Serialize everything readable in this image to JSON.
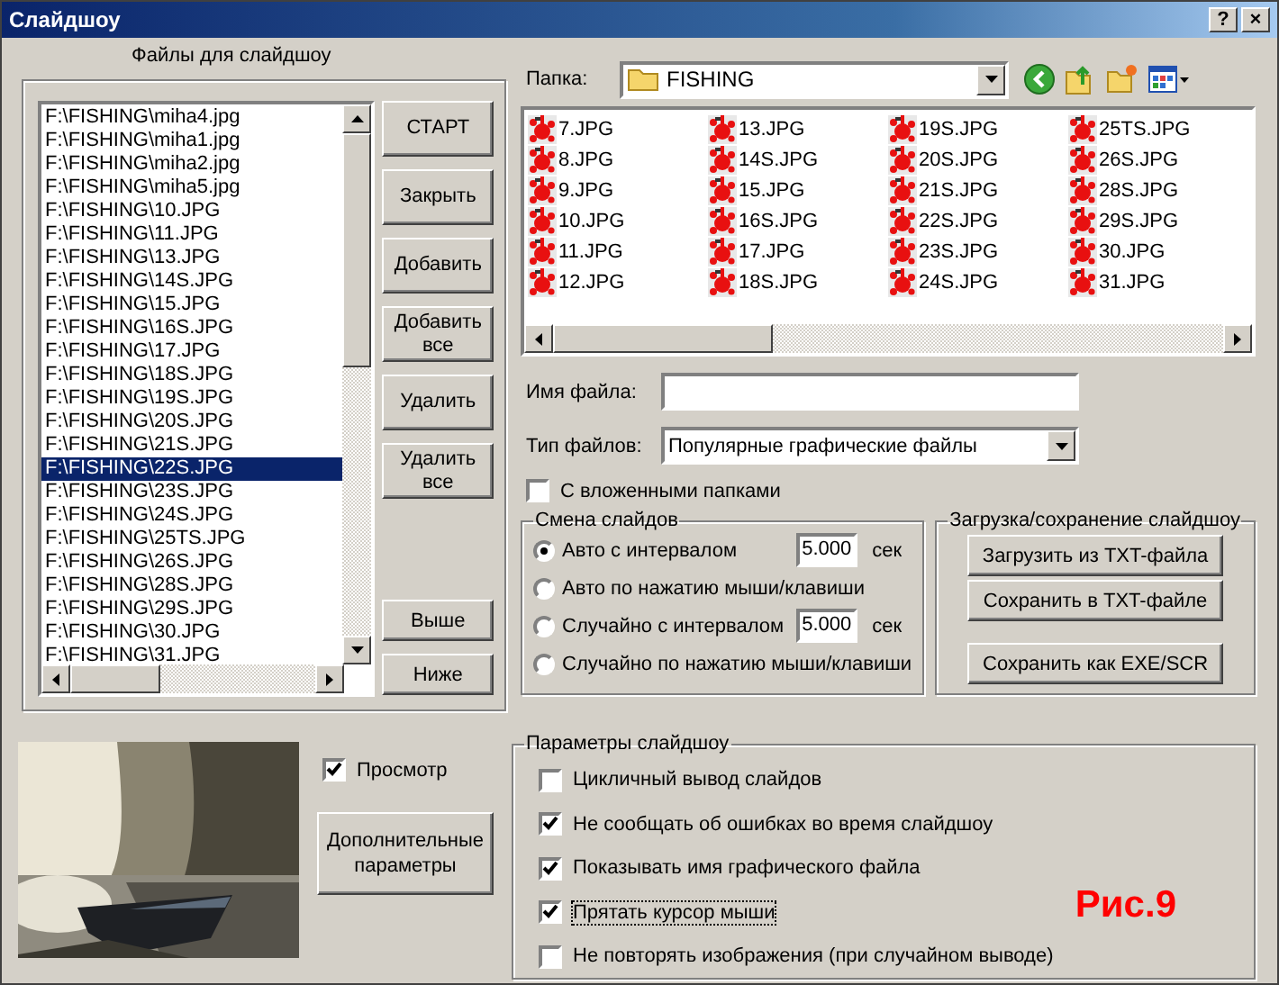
{
  "window": {
    "title": "Слайдшоу",
    "help_button": "?",
    "close_button": "×"
  },
  "files_panel": {
    "title": "Файлы для слайдшоу",
    "items": [
      {
        "name": "F:\\FISHING\\miha4.jpg",
        "selected": false
      },
      {
        "name": "F:\\FISHING\\miha1.jpg",
        "selected": false
      },
      {
        "name": "F:\\FISHING\\miha2.jpg",
        "selected": false
      },
      {
        "name": "F:\\FISHING\\miha5.jpg",
        "selected": false
      },
      {
        "name": "F:\\FISHING\\10.JPG",
        "selected": false
      },
      {
        "name": "F:\\FISHING\\11.JPG",
        "selected": false
      },
      {
        "name": "F:\\FISHING\\13.JPG",
        "selected": false
      },
      {
        "name": "F:\\FISHING\\14S.JPG",
        "selected": false
      },
      {
        "name": "F:\\FISHING\\15.JPG",
        "selected": false
      },
      {
        "name": "F:\\FISHING\\16S.JPG",
        "selected": false
      },
      {
        "name": "F:\\FISHING\\17.JPG",
        "selected": false
      },
      {
        "name": "F:\\FISHING\\18S.JPG",
        "selected": false
      },
      {
        "name": "F:\\FISHING\\19S.JPG",
        "selected": false
      },
      {
        "name": "F:\\FISHING\\20S.JPG",
        "selected": false
      },
      {
        "name": "F:\\FISHING\\21S.JPG",
        "selected": false
      },
      {
        "name": "F:\\FISHING\\22S.JPG",
        "selected": true
      },
      {
        "name": "F:\\FISHING\\23S.JPG",
        "selected": false
      },
      {
        "name": "F:\\FISHING\\24S.JPG",
        "selected": false
      },
      {
        "name": "F:\\FISHING\\25TS.JPG",
        "selected": false
      },
      {
        "name": "F:\\FISHING\\26S.JPG",
        "selected": false
      },
      {
        "name": "F:\\FISHING\\28S.JPG",
        "selected": false
      },
      {
        "name": "F:\\FISHING\\29S.JPG",
        "selected": false
      },
      {
        "name": "F:\\FISHING\\30.JPG",
        "selected": false
      },
      {
        "name": "F:\\FISHING\\31.JPG",
        "selected": false
      }
    ],
    "buttons_top": [
      "СТАРТ",
      "Закрыть",
      "Добавить",
      "Добавить все",
      "Удалить",
      "Удалить все"
    ],
    "buttons_bottom": [
      "Выше",
      "Ниже"
    ]
  },
  "folder": {
    "label": "Папка:",
    "value": "FISHING"
  },
  "files": [
    "7.JPG",
    "8.JPG",
    "9.JPG",
    "10.JPG",
    "11.JPG",
    "12.JPG",
    "13.JPG",
    "14S.JPG",
    "15.JPG",
    "16S.JPG",
    "17.JPG",
    "18S.JPG",
    "19S.JPG",
    "20S.JPG",
    "21S.JPG",
    "22S.JPG",
    "23S.JPG",
    "24S.JPG",
    "25TS.JPG",
    "26S.JPG",
    "28S.JPG",
    "29S.JPG",
    "30.JPG",
    "31.JPG"
  ],
  "file_name": {
    "label": "Имя файла:"
  },
  "file_type": {
    "label": "Тип файлов:",
    "value": "Популярные графические файлы"
  },
  "subfolders": {
    "label": "С вложенными папками",
    "checked": false
  },
  "slide_change": {
    "title": "Смена слайдов",
    "options": [
      {
        "label": "Авто  с  интервалом",
        "selected": true,
        "interval": "5.000",
        "unit": "сек"
      },
      {
        "label": "Авто по нажатию мыши/клавиши",
        "selected": false
      },
      {
        "label": "Случайно с интервалом",
        "selected": false,
        "interval": "5.000",
        "unit": "сек"
      },
      {
        "label": "Случайно по нажатию мыши/клавиши",
        "selected": false
      }
    ]
  },
  "save_load": {
    "title": "Загрузка/сохранение слайдшоу",
    "buttons": [
      "Загрузить из TXT-файла",
      "Сохранить в TXT-файле",
      "Сохранить как EXE/SCR"
    ]
  },
  "preview": {
    "label": "Просмотр",
    "checked": true
  },
  "more_button": "Дополнительные параметры",
  "params": {
    "title": "Параметры слайдшоу",
    "options": [
      {
        "label": "Цикличный вывод слайдов",
        "checked": false,
        "focused": false
      },
      {
        "label": "Не сообщать об ошибках во время слайдшоу",
        "checked": true,
        "focused": false
      },
      {
        "label": "Показывать имя графического файла",
        "checked": true,
        "focused": false
      },
      {
        "label": "Прятать курсор мыши",
        "checked": true,
        "focused": true
      },
      {
        "label": "Не повторять изображения (при случайном выводе)",
        "checked": false,
        "focused": false
      }
    ]
  },
  "figure_label": "Рис.9"
}
